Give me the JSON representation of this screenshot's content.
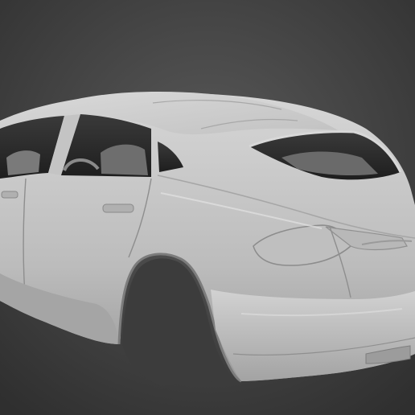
{
  "viewport": {
    "background_center": "#5a5a5a",
    "background_edge": "#2f2f2f",
    "model_base": "#c8c8c8",
    "model_light": "#dcdcdc",
    "model_shadow": "#8e8e8e",
    "interior_dark": "#2a2a2a",
    "interior_mid": "#7a7a7a"
  },
  "model": {
    "subject": "car-body-shell"
  }
}
